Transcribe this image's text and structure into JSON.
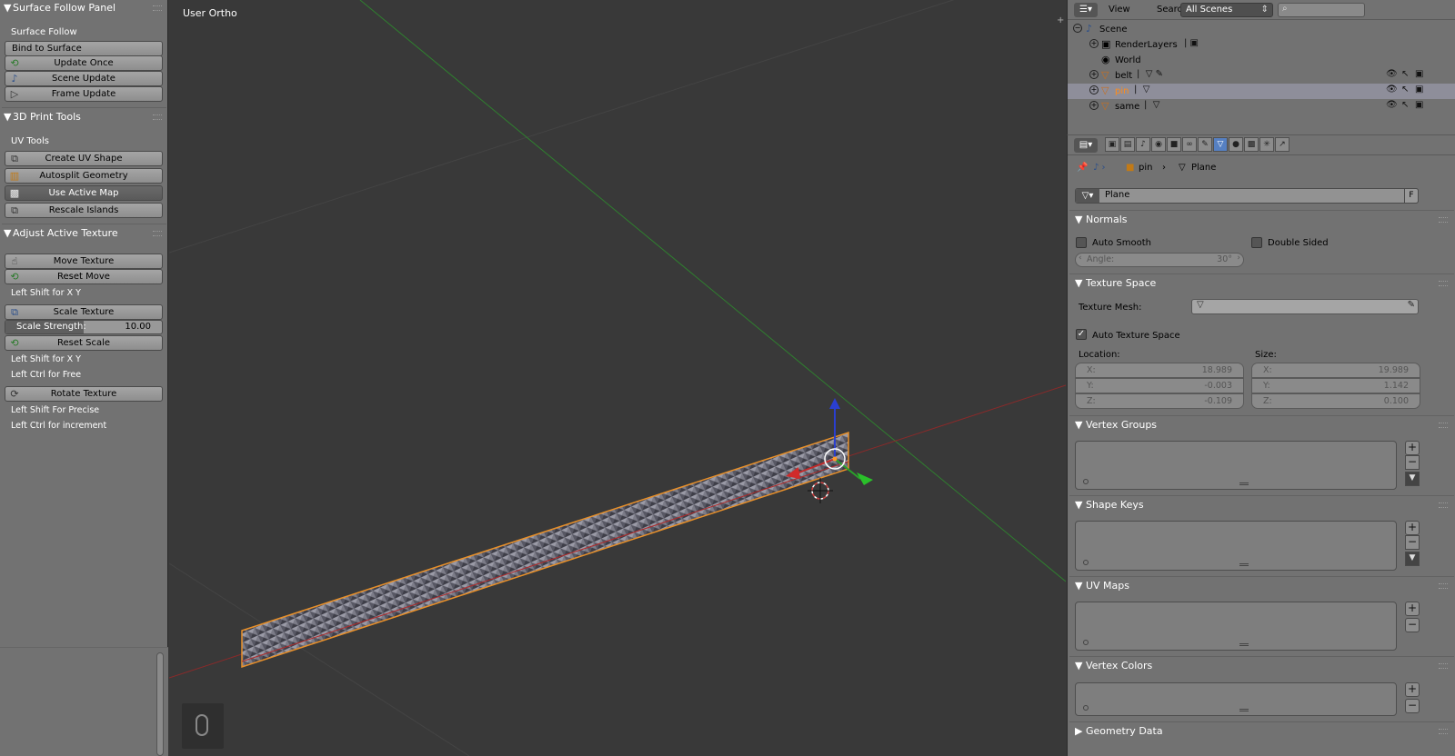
{
  "shelf": {
    "surface_follow": {
      "title": "Surface Follow Panel",
      "section_label": "Surface Follow",
      "bind_button": "Bind to Surface",
      "update_once": "Update Once",
      "scene_update": "Scene Update",
      "frame_update": "Frame Update"
    },
    "print_tools": {
      "title": "3D Print Tools",
      "section_label": "UV Tools",
      "create_uv": "Create UV Shape",
      "autosplit": "Autosplit Geometry",
      "use_active_map": "Use Active Map",
      "rescale": "Rescale Islands"
    },
    "adjust_texture": {
      "title": "Adjust Active Texture",
      "move_texture": "Move Texture",
      "reset_move": "Reset Move",
      "note_move": "Left Shift for X Y",
      "scale_texture": "Scale Texture",
      "scale_strength_label": "Scale Strength:",
      "scale_strength_value": "10.00",
      "scale_strength_fraction": 0.5,
      "reset_scale": "Reset Scale",
      "note_scale_1": "Left Shift for X Y",
      "note_scale_2": "Left Ctrl for Free",
      "rotate_texture": "Rotate Texture",
      "note_rotate_1": "Left Shift For Precise",
      "note_rotate_2": "Left Ctrl for increment"
    }
  },
  "viewport": {
    "title": "User Ortho",
    "plus": "+"
  },
  "outliner": {
    "menu_view": "View",
    "menu_search": "Search",
    "scene_select": "All Scenes",
    "rows": [
      {
        "label": "Scene"
      },
      {
        "label": "RenderLayers"
      },
      {
        "label": "World"
      },
      {
        "label": "belt"
      },
      {
        "label": "pin"
      },
      {
        "label": "same"
      }
    ]
  },
  "properties": {
    "breadcrumb_object": "pin",
    "breadcrumb_data": "Plane",
    "mesh_name": "Plane",
    "fake_user": "F",
    "normals": {
      "title": "Normals",
      "auto_smooth": "Auto Smooth",
      "double_sided": "Double Sided",
      "angle_label": "Angle:",
      "angle_value": "30°"
    },
    "texture_space": {
      "title": "Texture Space",
      "texture_mesh_label": "Texture Mesh:",
      "auto_texture_space": "Auto Texture Space",
      "location_label": "Location:",
      "size_label": "Size:",
      "location": [
        {
          "axis": "X:",
          "value": "18.989"
        },
        {
          "axis": "Y:",
          "value": "-0.003"
        },
        {
          "axis": "Z:",
          "value": "-0.109"
        }
      ],
      "size": [
        {
          "axis": "X:",
          "value": "19.989"
        },
        {
          "axis": "Y:",
          "value": "1.142"
        },
        {
          "axis": "Z:",
          "value": "0.100"
        }
      ]
    },
    "vertex_groups_title": "Vertex Groups",
    "shape_keys_title": "Shape Keys",
    "uv_maps_title": "UV Maps",
    "vertex_colors_title": "Vertex Colors",
    "geometry_data_title": "Geometry Data"
  }
}
